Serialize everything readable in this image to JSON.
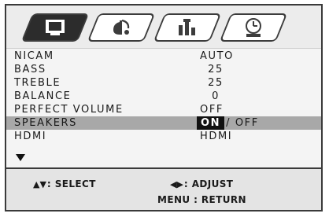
{
  "tabs": [
    {
      "name": "picture-icon",
      "active": true
    },
    {
      "name": "sound-icon",
      "active": false
    },
    {
      "name": "setup-icon",
      "active": false
    },
    {
      "name": "timer-icon",
      "active": false
    }
  ],
  "menu": {
    "rows": [
      {
        "label": "NICAM",
        "value": "AUTO"
      },
      {
        "label": "BASS",
        "value": "25"
      },
      {
        "label": "TREBLE",
        "value": "25"
      },
      {
        "label": "BALANCE",
        "value": "0"
      },
      {
        "label": "PERFECT VOLUME",
        "value": "OFF"
      },
      {
        "label": "SPEAKERS",
        "value_on": "ON",
        "value_rest": "/ OFF"
      },
      {
        "label": "HDMI",
        "value": "HDMI"
      }
    ],
    "more_icon": "down-triangle-icon"
  },
  "footer": {
    "select_arrows": "▲▼",
    "select": " : SELECT",
    "adjust_arrows": "◀▶",
    "adjust": " : ADJUST",
    "return": "MENU : RETURN"
  }
}
